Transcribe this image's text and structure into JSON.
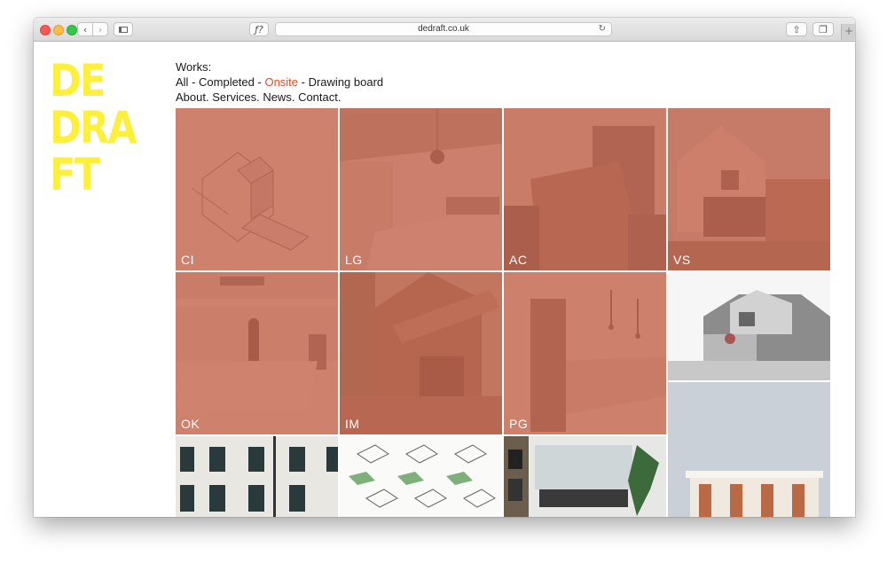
{
  "browser": {
    "url": "dedraft.co.uk",
    "format_icon": "ƒ?"
  },
  "logo": {
    "lines": [
      "DE",
      "DRA",
      "FT"
    ]
  },
  "nav": {
    "works_label": "Works:",
    "filters": [
      "All",
      "Completed",
      "Onsite",
      "Drawing board"
    ],
    "active_filter": "Onsite",
    "separator": " - ",
    "pages": [
      "About.",
      "Services.",
      "News.",
      "Contact."
    ]
  },
  "projects": [
    {
      "code": "CI"
    },
    {
      "code": "LG"
    },
    {
      "code": "AC"
    },
    {
      "code": "VS"
    },
    {
      "code": "OK"
    },
    {
      "code": "IM"
    },
    {
      "code": "PG"
    }
  ],
  "colors": {
    "logo_yellow": "#fdf03a",
    "accent": "#d8512d",
    "overlay": "#c66850"
  }
}
